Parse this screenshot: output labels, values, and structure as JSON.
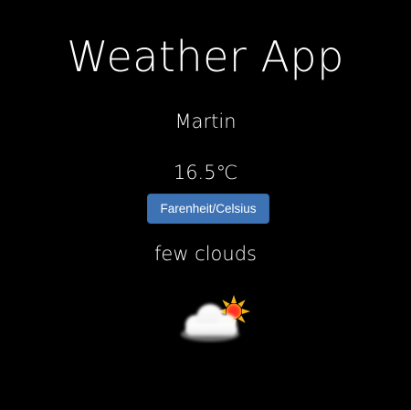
{
  "app": {
    "title": "Weather App",
    "city": "Martin",
    "temperature": "16.5℃",
    "toggle_button_label": "Farenheit/Celsius",
    "description": "few clouds",
    "weather_icon": "few-clouds-icon"
  },
  "colors": {
    "background": "#000000",
    "text": "#ffffff",
    "button": "#3d72b4"
  }
}
